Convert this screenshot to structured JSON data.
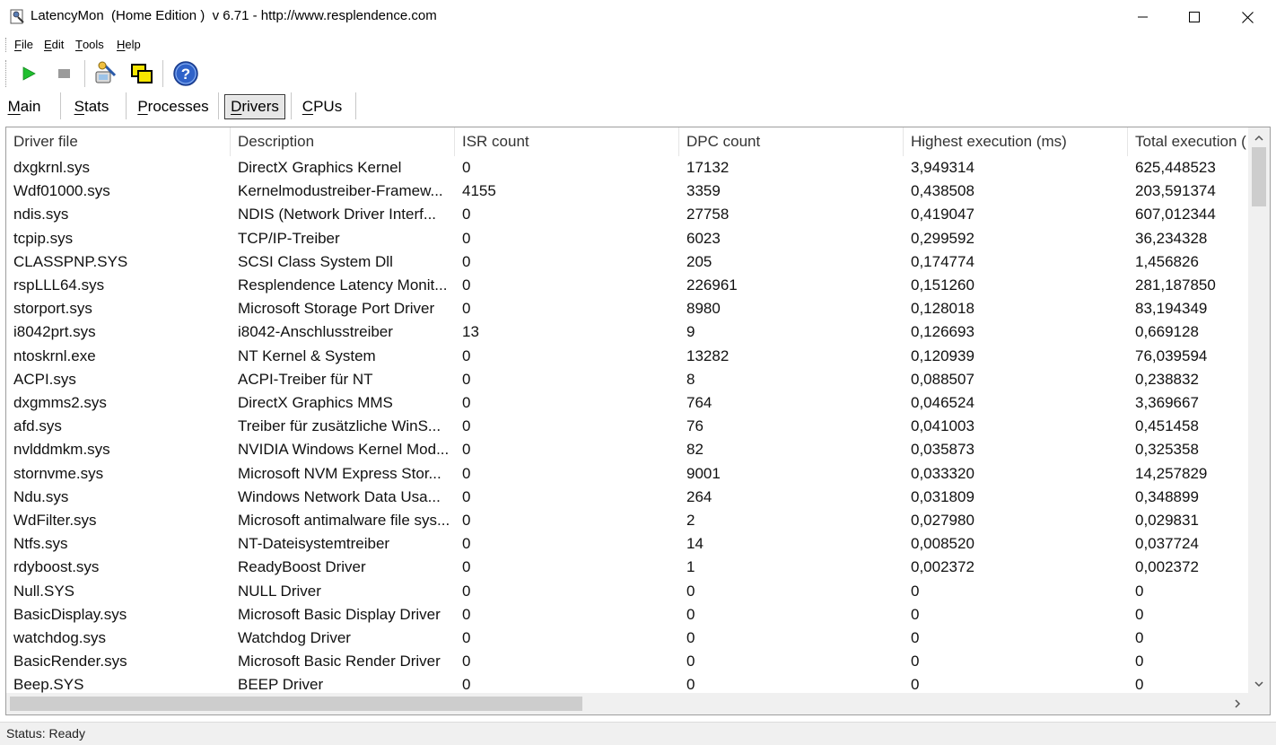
{
  "window": {
    "title": "LatencyMon  (Home Edition )  v 6.71 - http://www.resplendence.com"
  },
  "menu": {
    "items": [
      {
        "key": "F",
        "rest": "ile"
      },
      {
        "key": "E",
        "rest": "dit"
      },
      {
        "key": "T",
        "rest": "ools"
      },
      {
        "key": "H",
        "rest": "elp"
      }
    ]
  },
  "toolbar": {
    "buttons": [
      "play-icon",
      "stop-icon",
      "tools-icon",
      "windows-icon",
      "help-icon"
    ]
  },
  "tabs": [
    {
      "key": "M",
      "rest": "ain",
      "active": false
    },
    {
      "key": "S",
      "rest": "tats",
      "active": false
    },
    {
      "key": "P",
      "rest": "rocesses",
      "active": false
    },
    {
      "key": "D",
      "rest": "rivers",
      "active": true
    },
    {
      "key": "C",
      "rest": "PUs",
      "active": false
    }
  ],
  "table": {
    "columns": [
      "Driver file",
      "Description",
      "ISR count",
      "DPC count",
      "Highest execution (ms)",
      "Total execution ("
    ],
    "rows": [
      [
        "dxgkrnl.sys",
        "DirectX Graphics Kernel",
        "0",
        "17132",
        "3,949314",
        "625,448523"
      ],
      [
        "Wdf01000.sys",
        "Kernelmodustreiber-Framew...",
        "4155",
        "3359",
        "0,438508",
        "203,591374"
      ],
      [
        "ndis.sys",
        "NDIS (Network Driver Interf...",
        "0",
        "27758",
        "0,419047",
        "607,012344"
      ],
      [
        "tcpip.sys",
        "TCP/IP-Treiber",
        "0",
        "6023",
        "0,299592",
        "36,234328"
      ],
      [
        "CLASSPNP.SYS",
        "SCSI Class System Dll",
        "0",
        "205",
        "0,174774",
        "1,456826"
      ],
      [
        "rspLLL64.sys",
        "Resplendence Latency Monit...",
        "0",
        "226961",
        "0,151260",
        "281,187850"
      ],
      [
        "storport.sys",
        "Microsoft Storage Port Driver",
        "0",
        "8980",
        "0,128018",
        "83,194349"
      ],
      [
        "i8042prt.sys",
        "i8042-Anschlusstreiber",
        "13",
        "9",
        "0,126693",
        "0,669128"
      ],
      [
        "ntoskrnl.exe",
        "NT Kernel & System",
        "0",
        "13282",
        "0,120939",
        "76,039594"
      ],
      [
        "ACPI.sys",
        "ACPI-Treiber für NT",
        "0",
        "8",
        "0,088507",
        "0,238832"
      ],
      [
        "dxgmms2.sys",
        "DirectX Graphics MMS",
        "0",
        "764",
        "0,046524",
        "3,369667"
      ],
      [
        "afd.sys",
        "Treiber für zusätzliche WinS...",
        "0",
        "76",
        "0,041003",
        "0,451458"
      ],
      [
        "nvlddmkm.sys",
        "NVIDIA Windows Kernel Mod...",
        "0",
        "82",
        "0,035873",
        "0,325358"
      ],
      [
        "stornvme.sys",
        "Microsoft NVM Express Stor...",
        "0",
        "9001",
        "0,033320",
        "14,257829"
      ],
      [
        "Ndu.sys",
        "Windows Network Data Usa...",
        "0",
        "264",
        "0,031809",
        "0,348899"
      ],
      [
        "WdFilter.sys",
        "Microsoft antimalware file sys...",
        "0",
        "2",
        "0,027980",
        "0,029831"
      ],
      [
        "Ntfs.sys",
        "NT-Dateisystemtreiber",
        "0",
        "14",
        "0,008520",
        "0,037724"
      ],
      [
        "rdyboost.sys",
        "ReadyBoost Driver",
        "0",
        "1",
        "0,002372",
        "0,002372"
      ],
      [
        "Null.SYS",
        "NULL Driver",
        "0",
        "0",
        "0",
        "0"
      ],
      [
        "BasicDisplay.sys",
        "Microsoft Basic Display Driver",
        "0",
        "0",
        "0",
        "0"
      ],
      [
        "watchdog.sys",
        "Watchdog Driver",
        "0",
        "0",
        "0",
        "0"
      ],
      [
        "BasicRender.sys",
        "Microsoft Basic Render Driver",
        "0",
        "0",
        "0",
        "0"
      ],
      [
        "Beep.SYS",
        "BEEP Driver",
        "0",
        "0",
        "0",
        "0"
      ]
    ]
  },
  "status": {
    "text": "Status: Ready"
  }
}
